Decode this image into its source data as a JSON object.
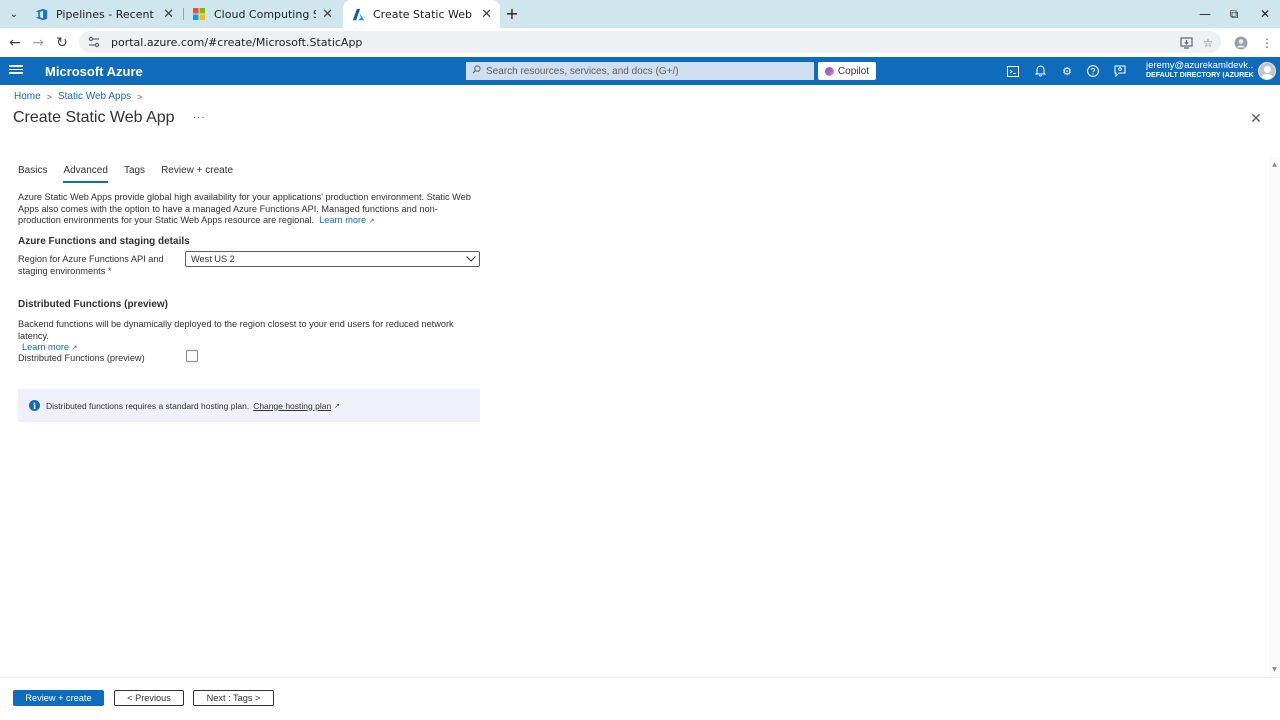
{
  "browser": {
    "tabs": [
      {
        "title": "Pipelines - Recent",
        "active": false
      },
      {
        "title": "Cloud Computing Services | Mi",
        "active": false
      },
      {
        "title": "Create Static Web App - Micro",
        "active": true
      }
    ],
    "url": "portal.azure.com/#create/Microsoft.StaticApp"
  },
  "azure": {
    "brand": "Microsoft Azure",
    "search_placeholder": "Search resources, services, and docs (G+/)",
    "copilot_label": "Copilot",
    "account_email": "jeremy@azurekamldevk...",
    "account_directory": "DEFAULT DIRECTORY (AZUREKA..."
  },
  "breadcrumb": {
    "items": [
      "Home",
      "Static Web Apps"
    ]
  },
  "page": {
    "title": "Create Static Web App",
    "more": "···"
  },
  "tabs": {
    "items": [
      "Basics",
      "Advanced",
      "Tags",
      "Review + create"
    ],
    "active_index": 1
  },
  "intro": {
    "text": "Azure Static Web Apps provide global high availability for your applications' production environment. Static Web Apps also comes with the option to have a managed Azure Functions API. Managed functions and non-production environments for your Static Web Apps resource are regional.",
    "learn_more": "Learn more"
  },
  "functions_section": {
    "heading": "Azure Functions and staging details",
    "region_label_line1": "Region for Azure Functions API and",
    "region_label_line2": "staging environments",
    "required_mark": "*",
    "region_value": "West US 2"
  },
  "distributed_section": {
    "heading": "Distributed Functions (preview)",
    "description": "Backend functions will be dynamically deployed to the region closest to your end users for reduced network latency.",
    "learn_more": "Learn more",
    "checkbox_label": "Distributed Functions (preview)",
    "checkbox_checked": false
  },
  "info_bar": {
    "text": "Distributed functions requires a standard hosting plan.",
    "link": "Change hosting plan"
  },
  "footer": {
    "review_create": "Review + create",
    "previous": "< Previous",
    "next": "Next : Tags >"
  },
  "colors": {
    "azure_blue": "#0f6cbd",
    "tabstrip": "#cfe6ee",
    "info_bg": "#f0f0fb"
  }
}
